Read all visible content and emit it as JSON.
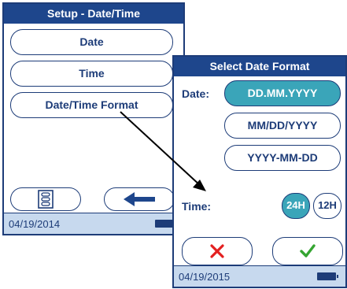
{
  "setup_screen": {
    "title": "Setup - Date/Time",
    "menu": [
      {
        "label": "Date"
      },
      {
        "label": "Time"
      },
      {
        "label": "Date/Time Format"
      }
    ],
    "menu_icon": "list-menu-icon",
    "back_icon": "arrow-left-icon",
    "status_date": "04/19/2014"
  },
  "format_screen": {
    "title": "Select Date Format",
    "date_label": "Date:",
    "date_options": [
      {
        "label": "DD.MM.YYYY",
        "selected": true
      },
      {
        "label": "MM/DD/YYYY",
        "selected": false
      },
      {
        "label": "YYYY-MM-DD",
        "selected": false
      }
    ],
    "time_label": "Time:",
    "time_options": [
      {
        "label": "24H",
        "selected": true
      },
      {
        "label": "12H",
        "selected": false
      }
    ],
    "cancel_icon": "cross-icon",
    "confirm_icon": "checkmark-icon",
    "status_date": "04/19/2015"
  },
  "colors": {
    "title_bar": "#1e468c",
    "outline": "#1d3c78",
    "selected": "#3aa5b9",
    "status_bar": "#c7d9ee",
    "cancel": "#e32020",
    "confirm": "#35a532"
  }
}
